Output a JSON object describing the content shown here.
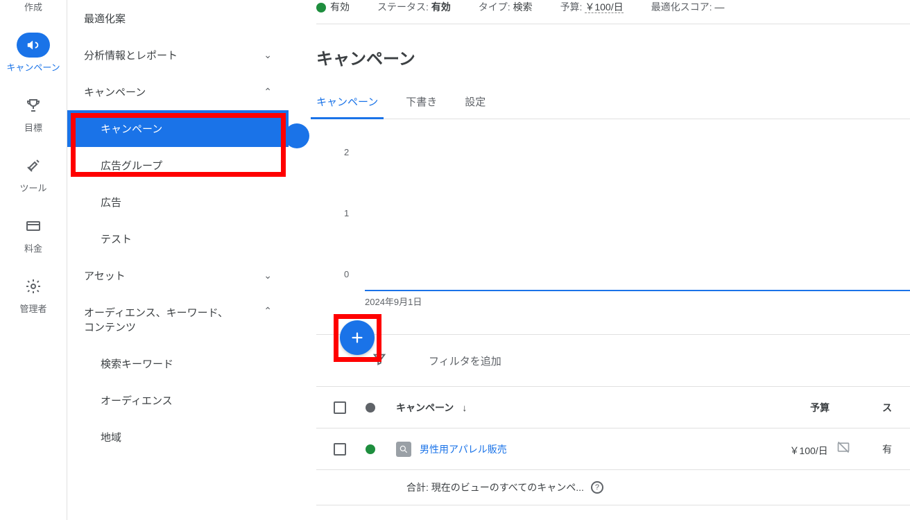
{
  "rail": {
    "create_trunc": "作成",
    "items": [
      {
        "id": "campaigns",
        "label": "キャンペーン",
        "icon": "megaphone",
        "active": true
      },
      {
        "id": "goals",
        "label": "目標",
        "icon": "trophy"
      },
      {
        "id": "tools",
        "label": "ツール",
        "icon": "wrench"
      },
      {
        "id": "billing",
        "label": "料金",
        "icon": "card"
      },
      {
        "id": "admin",
        "label": "管理者",
        "icon": "gear"
      }
    ]
  },
  "nav2": {
    "items": [
      {
        "label": "最適化案",
        "type": "item"
      },
      {
        "label": "分析情報とレポート",
        "type": "expandable",
        "expanded": false
      },
      {
        "label": "キャンペーン",
        "type": "expandable",
        "expanded": true,
        "children": [
          {
            "label": "キャンペーン",
            "selected": true
          },
          {
            "label": "広告グループ"
          },
          {
            "label": "広告"
          },
          {
            "label": "テスト"
          }
        ]
      },
      {
        "label": "アセット",
        "type": "expandable",
        "expanded": false
      },
      {
        "label": "オーディエンス、キーワード、コンテンツ",
        "type": "expandable",
        "expanded": true,
        "children": [
          {
            "label": "検索キーワード"
          },
          {
            "label": "オーディエンス"
          },
          {
            "label": "地域"
          }
        ]
      }
    ]
  },
  "status": {
    "enabled": "有効",
    "status_label": "ステータス:",
    "status_value": "有効",
    "type_label": "タイプ:",
    "type_value": "検索",
    "budget_label": "予算:",
    "budget_value": "￥100/日",
    "score_label": "最適化スコア:",
    "score_value": "—"
  },
  "page_title": "キャンペーン",
  "tabs": [
    {
      "label": "キャンペーン",
      "active": true
    },
    {
      "label": "下書き"
    },
    {
      "label": "設定"
    }
  ],
  "chart_data": {
    "type": "line",
    "title": "",
    "xlabel": "",
    "ylabel": "",
    "ylim": [
      0,
      2
    ],
    "x": [
      "2024年9月1日"
    ],
    "values": [
      0
    ],
    "yticks": [
      "0",
      "1",
      "2"
    ],
    "xticks": [
      "2024年9月1日"
    ]
  },
  "filter": {
    "placeholder": "フィルタを追加"
  },
  "table": {
    "headers": {
      "campaign": "キャンペーン",
      "budget": "予算",
      "status_col": "ス"
    },
    "sort_indicator": "↓",
    "rows": [
      {
        "status": "green",
        "icon": "search",
        "name": "男性用アパレル販売",
        "budget": "￥100/日",
        "status_col": "有"
      }
    ],
    "summary": "合計: 現在のビューのすべてのキャンペ..."
  }
}
